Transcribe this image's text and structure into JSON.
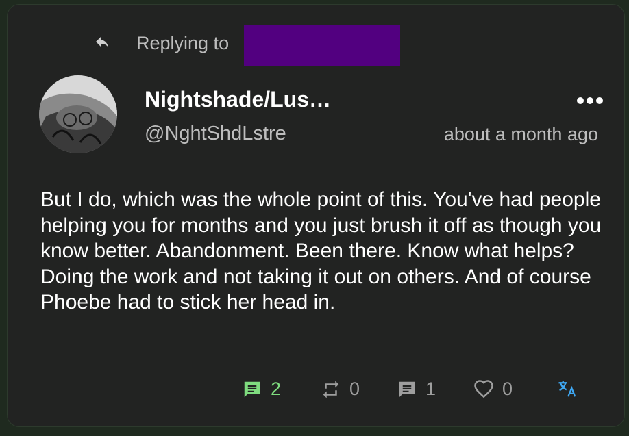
{
  "reply": {
    "label": "Replying to"
  },
  "post": {
    "display_name": "Nightshade/Lus…",
    "handle": "@NghtShdLstre",
    "time": "about a month ago",
    "text": "But I do, which was the whole point of this. You've had people helping you for months and you just brush it off as though you know better. Abandonment. Been there. Know what helps? Doing the work and not taking it out on others. And of course Phoebe had to stick her head in."
  },
  "actions": {
    "replies": "2",
    "reposts": "0",
    "quotes": "1",
    "likes": "0"
  },
  "colors": {
    "redaction": "#520080",
    "reply_accent": "#7fdc7f",
    "translate_accent": "#3fa9f5",
    "muted": "#9e9e9e"
  },
  "icons": [
    "reply-arrow-icon",
    "avatar",
    "more-icon",
    "comment-icon",
    "repost-icon",
    "quote-icon",
    "heart-icon",
    "translate-icon"
  ]
}
